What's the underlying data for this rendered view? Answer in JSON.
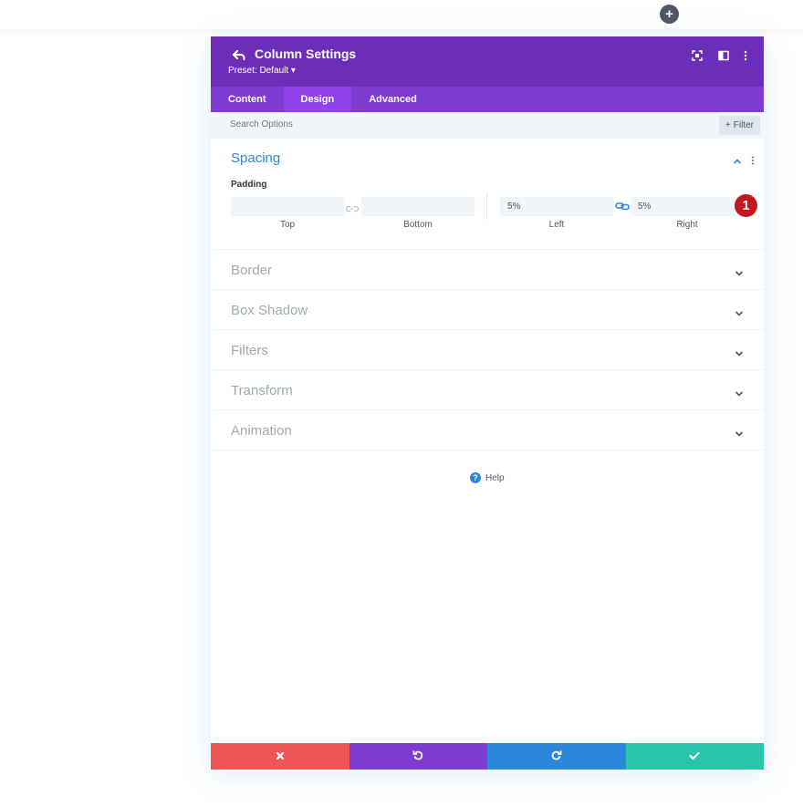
{
  "page": {
    "add_icon_glyph": "+"
  },
  "modal": {
    "title": "Column Settings",
    "preset": "Preset: Default ▾",
    "header_icons": [
      "back-arrow-icon",
      "fullscreen-icon",
      "split-view-icon",
      "kebab-menu-icon"
    ],
    "colors": {
      "header": "#6c2eb9",
      "tabs": "#7e3bd0",
      "active_tab": "#8f42ec",
      "accent_blue": "#2b87da",
      "cancel": "#ef5555",
      "undo": "#7e3bd0",
      "redo": "#2b87da",
      "save": "#29c4a9"
    }
  },
  "tabs": [
    {
      "label": "Content",
      "active": false
    },
    {
      "label": "Design",
      "active": true
    },
    {
      "label": "Advanced",
      "active": false
    }
  ],
  "search": {
    "placeholder": "Search Options",
    "filter_label": "Filter",
    "filter_glyph": "+"
  },
  "spacing": {
    "title": "Spacing",
    "padding_label": "Padding",
    "fields": [
      {
        "caption": "Top",
        "value": ""
      },
      {
        "caption": "Bottom",
        "value": ""
      },
      {
        "caption": "Left",
        "value": "5%"
      },
      {
        "caption": "Right",
        "value": "5%"
      }
    ],
    "badge": "1"
  },
  "sections": [
    {
      "title": "Border"
    },
    {
      "title": "Box Shadow"
    },
    {
      "title": "Filters"
    },
    {
      "title": "Transform"
    },
    {
      "title": "Animation"
    }
  ],
  "help": {
    "label": "Help",
    "glyph": "?"
  },
  "footer": {
    "buttons": [
      "cancel-icon",
      "undo-icon",
      "redo-icon",
      "checkmark-icon"
    ]
  }
}
